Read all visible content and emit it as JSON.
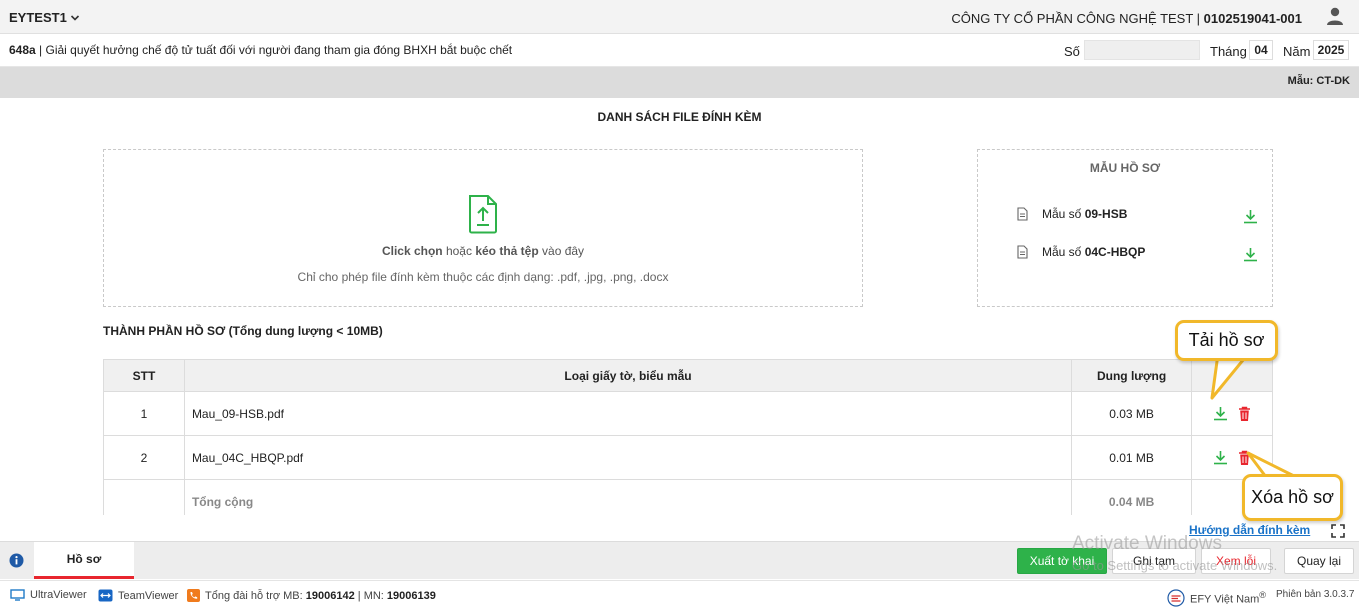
{
  "header": {
    "account": "EYTEST1",
    "company_name": "CÔNG TY CỔ PHẦN CÔNG NGHỆ TEST",
    "separator": " | ",
    "tax_code": "0102519041-001"
  },
  "form": {
    "code": "648a",
    "title": " | Giải quyết hưởng chế độ tử tuất đối với người đang tham gia đóng BHXH bắt buộc chết",
    "so_label": "Số",
    "so_value": "",
    "thang_label": "Tháng",
    "thang_value": "04",
    "nam_label": "Năm",
    "nam_value": "2025",
    "template_code": "Mẫu: CT-DK"
  },
  "attachments": {
    "title": "DANH SÁCH FILE ĐÍNH KÈM",
    "drop_click": "Click chọn",
    "drop_or": " hoặc ",
    "drop_drag": "kéo thả tệp",
    "drop_here": " vào đây",
    "drop_hint": "Chỉ cho phép file đính kèm thuộc các định dạng: .pdf, .jpg, .png, .docx"
  },
  "samples": {
    "title": "MẪU HỒ SƠ",
    "items": [
      {
        "prefix": "Mẫu số ",
        "code": "09-HSB"
      },
      {
        "prefix": "Mẫu số ",
        "code": "04C-HBQP"
      }
    ]
  },
  "components": {
    "title": "THÀNH PHẦN HỒ SƠ (Tổng dung lượng < 10MB)",
    "columns": {
      "stt": "STT",
      "name": "Loại giấy tờ, biểu mẫu",
      "size": "Dung lượng",
      "actions": ""
    },
    "rows": [
      {
        "stt": "1",
        "name": "Mau_09-HSB.pdf",
        "size": "0.03 MB"
      },
      {
        "stt": "2",
        "name": "Mau_04C_HBQP.pdf",
        "size": "0.01 MB"
      }
    ],
    "total_label": "Tổng cộng",
    "total_size": "0.04 MB"
  },
  "guide_link": "Hướng dẫn đính kèm",
  "tabs": {
    "hoso": "Hồ sơ"
  },
  "buttons": {
    "xuat": "Xuất tờ khai",
    "ghi": "Ghi tạm",
    "xem": "Xem lỗi",
    "quay": "Quay lại"
  },
  "watermark": {
    "line1": "Activate Windows",
    "line2": "Go to Settings to activate Windows."
  },
  "statusbar": {
    "ultraviewer": "UltraViewer",
    "teamviewer": "TeamViewer",
    "support_label": "Tổng đài hỗ trợ MB: ",
    "support_mb": "19006142",
    "support_sep": " | MN: ",
    "support_mn": "19006139",
    "efy": "EFY Việt Nam",
    "efy_mark": "®",
    "version": "Phiên bản 3.0.3.7"
  },
  "callouts": {
    "download": "Tải hồ sơ",
    "delete": "Xóa hồ sơ"
  },
  "colors": {
    "accent_green": "#2eb24a",
    "danger_red": "#e8262e",
    "link_blue": "#1a73c8",
    "callout_border": "#f1b82a"
  }
}
